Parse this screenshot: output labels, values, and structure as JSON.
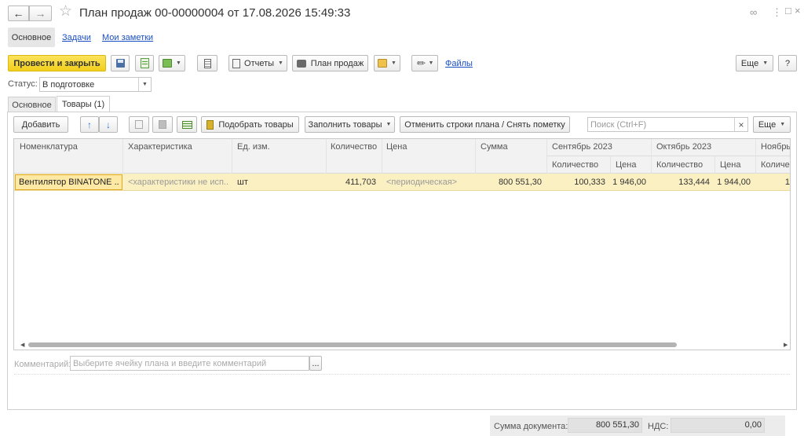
{
  "window": {
    "title": "План продаж 00-00000004 от 17.08.2026 15:49:33"
  },
  "nav_tabs": [
    {
      "label": "Основное"
    },
    {
      "label": "Задачи"
    },
    {
      "label": "Мои заметки"
    }
  ],
  "toolbar": {
    "post_close_label": "Провести и закрыть",
    "reports_label": "Отчеты",
    "sales_plan_label": "План продаж",
    "files_label": "Файлы",
    "more_label": "Еще",
    "help_label": "?"
  },
  "status": {
    "label": "Статус:",
    "value": "В подготовке"
  },
  "page_tabs": [
    {
      "label": "Основное"
    },
    {
      "label": "Товары (1)"
    }
  ],
  "goods_toolbar": {
    "add_label": "Добавить",
    "pick_label": "Подобрать товары",
    "fill_label": "Заполнить товары",
    "cancel_rows_label": "Отменить строки плана / Снять пометку",
    "search_placeholder": "Поиск (Ctrl+F)",
    "more_label": "Еще"
  },
  "table": {
    "columns": {
      "nomenclature": "Номенклатура",
      "characteristic": "Характеристика",
      "unit": "Ед. изм.",
      "quantity": "Количество",
      "price": "Цена",
      "sum": "Сумма",
      "sep": "Сентябрь 2023",
      "oct": "Октябрь 2023",
      "nov": "Ноябрь",
      "sub_qty": "Количество",
      "sub_price": "Цена",
      "sub_qty_nov": "Количес"
    },
    "rows": [
      {
        "nomenclature": "Вентилятор BINATONE ...",
        "characteristic": "<характеристики не исп...",
        "unit": "шт",
        "quantity": "411,703",
        "price": "<периодическая>",
        "sum": "800 551,30",
        "sep_qty": "100,333",
        "sep_price": "1 946,00",
        "oct_qty": "133,444",
        "oct_price": "1 944,00",
        "nov_qty": "1"
      }
    ]
  },
  "comment": {
    "label": "Комментарий:",
    "placeholder": "Выберите ячейку плана и введите комментарий",
    "ellipsis": "..."
  },
  "footer": {
    "sum_label": "Сумма документа:",
    "sum_value": "800 551,30",
    "vat_label": "НДС:",
    "vat_value": "0,00"
  },
  "colors": {
    "accent_yellow": "#f7d828",
    "selected_row": "#fbf0c2",
    "link_blue": "#1a4fc4"
  }
}
